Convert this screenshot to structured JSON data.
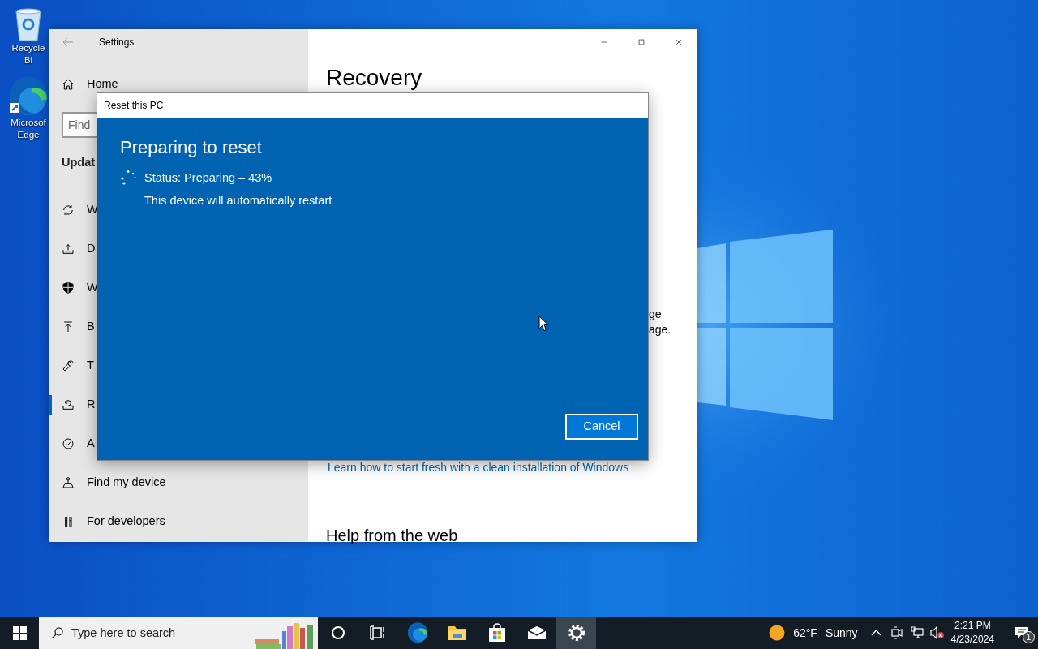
{
  "desktop": {
    "icons": [
      {
        "kind": "recycle",
        "label": "Recycle Bi"
      },
      {
        "kind": "edge",
        "label": "Microsof Edge"
      }
    ]
  },
  "settings": {
    "title": "Settings",
    "home": "Home",
    "search": {
      "placeholder": "Find"
    },
    "section": "Updat",
    "nav": [
      {
        "kind": "sync",
        "label": "W",
        "selected": false
      },
      {
        "kind": "delivery",
        "label": "D",
        "selected": false
      },
      {
        "kind": "shield",
        "label": "W",
        "selected": false
      },
      {
        "kind": "backup",
        "label": "B",
        "selected": false
      },
      {
        "kind": "wrench",
        "label": "T",
        "selected": false
      },
      {
        "kind": "recovery",
        "label": "R",
        "selected": true
      },
      {
        "kind": "check",
        "label": "A",
        "selected": false
      },
      {
        "kind": "find",
        "label": "Find my device",
        "selected": false
      },
      {
        "kind": "dev",
        "label": "For developers",
        "selected": false
      }
    ],
    "content": {
      "heading": "Recovery",
      "fragments": [
        "ge",
        "age."
      ],
      "link": "Learn how to start fresh with a clean installation of Windows",
      "subheading": "Help from the web"
    }
  },
  "dialog": {
    "title": "Reset this PC",
    "heading": "Preparing to reset",
    "status": "Status: Preparing – 43%",
    "note": "This device will automatically restart",
    "button": "Cancel"
  },
  "taskbar": {
    "search": {
      "placeholder": "Type here to search"
    },
    "apps": [
      {
        "kind": "cortana",
        "selected": false
      },
      {
        "kind": "taskview",
        "selected": false
      },
      {
        "kind": "edge",
        "selected": false
      },
      {
        "kind": "explorer",
        "selected": false
      },
      {
        "kind": "store",
        "selected": false
      },
      {
        "kind": "mail",
        "selected": false
      },
      {
        "kind": "settings",
        "selected": true
      }
    ],
    "weather": {
      "temperature": "62°F",
      "condition": "Sunny"
    },
    "time": "2:21 PM",
    "date": "4/23/2024",
    "notifications": "1"
  }
}
